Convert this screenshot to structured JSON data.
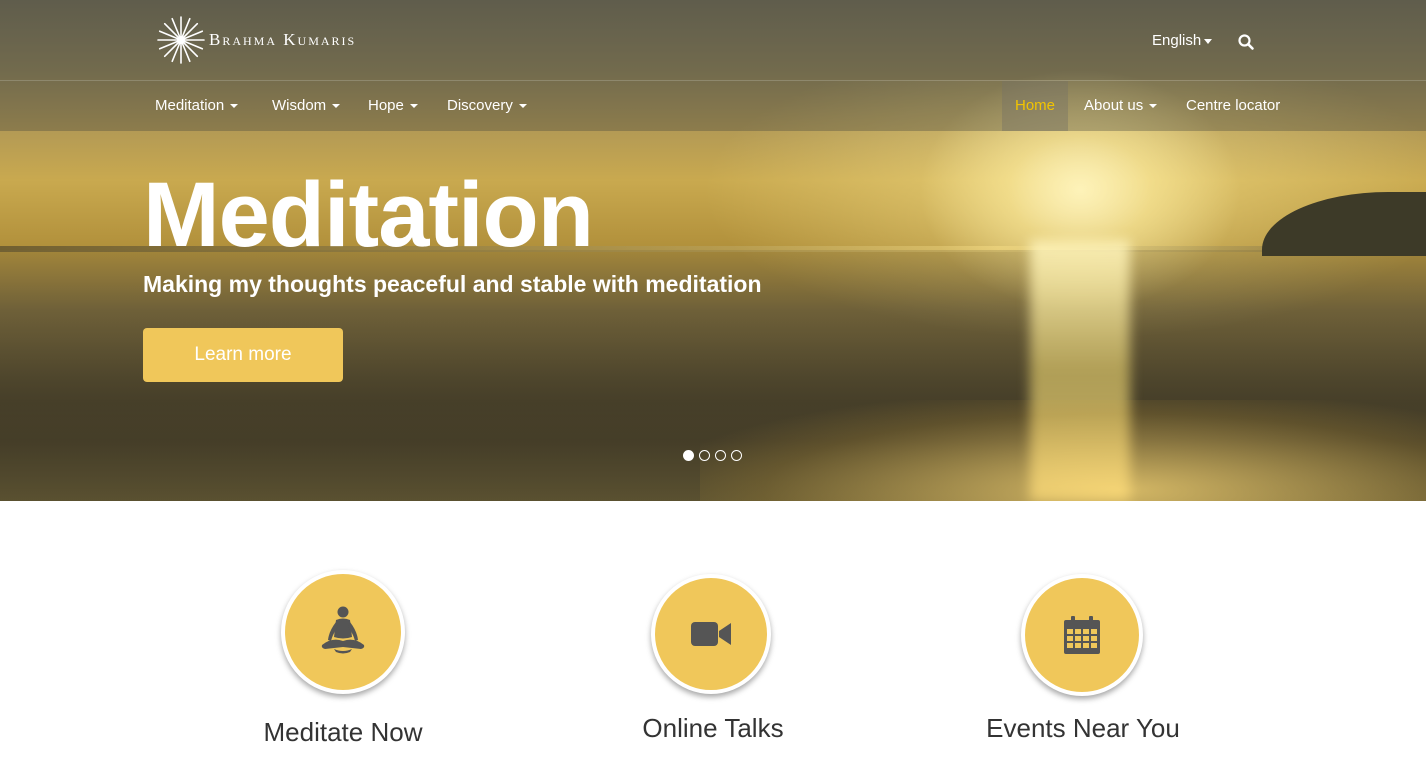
{
  "header": {
    "brand": "Brahma Kumaris",
    "language": "English",
    "search_icon": "search-icon"
  },
  "nav": {
    "left": [
      "Meditation",
      "Wisdom",
      "Hope",
      "Discovery"
    ],
    "right": [
      "Home",
      "About us",
      "Centre locator"
    ],
    "active": "Home"
  },
  "hero": {
    "title": "Meditation",
    "subtitle": "Making my thoughts peaceful and stable with meditation",
    "button_label": "Learn more",
    "slide_count": 4,
    "active_slide": 1
  },
  "features": [
    {
      "label": "Meditate Now",
      "icon": "meditation-figure-icon"
    },
    {
      "label": "Online Talks",
      "icon": "video-camera-icon"
    },
    {
      "label": "Events Near You",
      "icon": "calendar-icon"
    }
  ],
  "colors": {
    "accent": "#f0c75a",
    "active_nav": "#f2c400",
    "text_dark": "#333333"
  }
}
